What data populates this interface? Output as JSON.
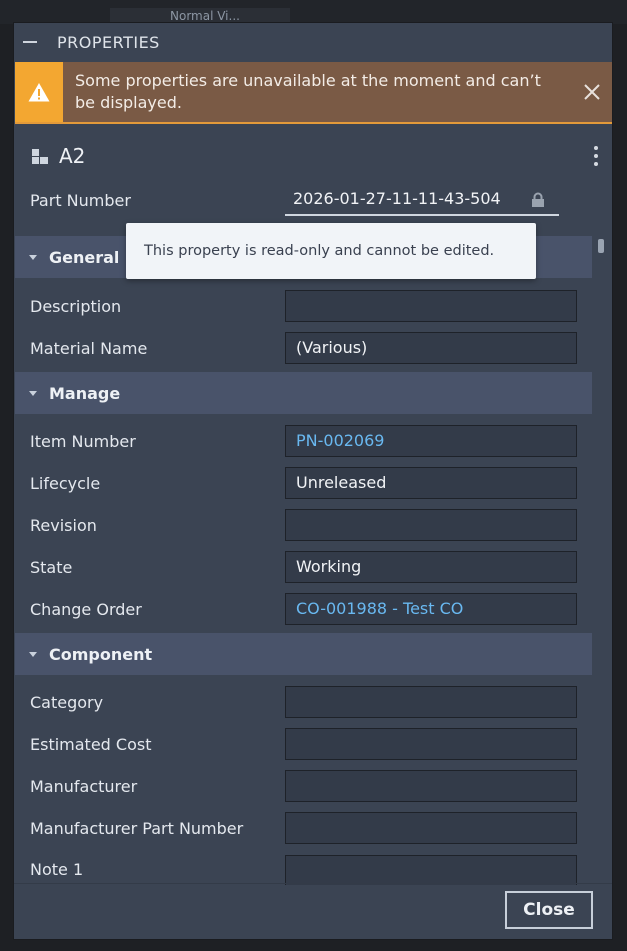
{
  "background": {
    "tab_text": "Normal Vi..."
  },
  "panel": {
    "title": "PROPERTIES",
    "warning": "Some properties are unavailable at the moment and can’t be displayed.",
    "part_title": "A2",
    "part_number": {
      "label": "Part Number",
      "value": "2026-01-27-11-11-43-504"
    },
    "tooltip": "This property is read-only and cannot be edited.",
    "sections": {
      "general": {
        "label": "General",
        "rows": [
          {
            "label": "Description",
            "value": ""
          },
          {
            "label": "Material Name",
            "value": "(Various)"
          }
        ]
      },
      "manage": {
        "label": "Manage",
        "rows": [
          {
            "label": "Item Number",
            "value": "PN-002069"
          },
          {
            "label": "Lifecycle",
            "value": "Unreleased"
          },
          {
            "label": "Revision",
            "value": ""
          },
          {
            "label": "State",
            "value": "Working"
          },
          {
            "label": "Change Order",
            "value": "CO-001988 - Test CO"
          }
        ]
      },
      "component": {
        "label": "Component",
        "rows": [
          {
            "label": "Category",
            "value": ""
          },
          {
            "label": "Estimated Cost",
            "value": ""
          },
          {
            "label": "Manufacturer",
            "value": ""
          },
          {
            "label": "Manufacturer Part Number",
            "value": ""
          },
          {
            "label": "Note 1",
            "value": ""
          }
        ]
      }
    },
    "close_label": "Close",
    "icons": {
      "warning": "warning-icon",
      "close": "close-icon",
      "part": "part-icon",
      "more": "more-vertical-icon",
      "lock": "lock-icon",
      "minimize": "minimize-icon"
    },
    "colors": {
      "accent_link": "#69b8f0",
      "warning": "#f3a731",
      "panel": "#3b4453"
    }
  }
}
